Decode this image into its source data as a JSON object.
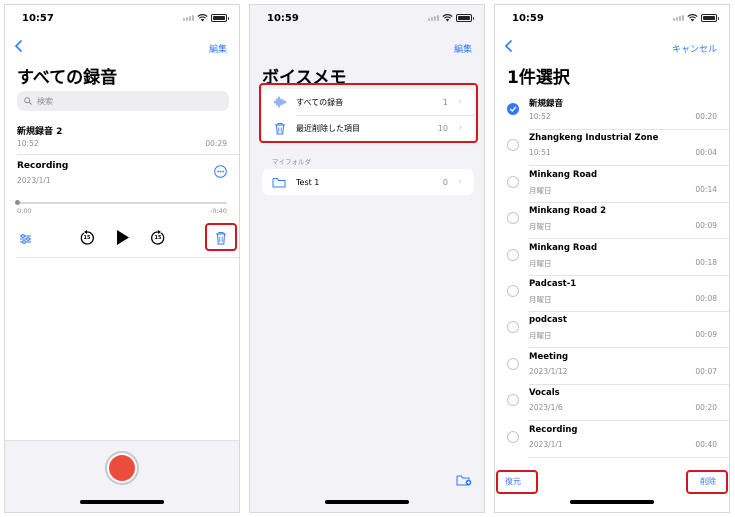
{
  "panel1": {
    "time": "10:57",
    "edit": "編集",
    "title": "すべての録音",
    "search_placeholder": "検索",
    "rec1": {
      "name": "新規録音 2",
      "date": "10:52",
      "duration": "00:29"
    },
    "rec2": {
      "name": "Recording",
      "date": "2023/1/1",
      "elapsed": "0:00",
      "remaining": "-0:40",
      "progress": 0.0
    },
    "icons": [
      "back-chevron",
      "search",
      "more",
      "options",
      "skip-back-15",
      "play",
      "skip-forward-15",
      "trash",
      "record"
    ],
    "skip_label": "15"
  },
  "panel2": {
    "time": "10:59",
    "edit": "編集",
    "title": "ボイスメモ",
    "rows": [
      {
        "label": "すべての録音",
        "count": "1"
      },
      {
        "label": "最近削除した項目",
        "count": "10"
      }
    ],
    "section": "マイフォルダ",
    "folder": {
      "label": "Test 1",
      "count": "0"
    }
  },
  "panel3": {
    "time": "10:59",
    "cancel": "キャンセル",
    "title": "1件選択",
    "items": [
      {
        "name": "新規録音",
        "date": "10:52",
        "duration": "00:20",
        "selected": true
      },
      {
        "name": "Zhangkeng Industrial Zone",
        "date": "10:51",
        "duration": "00:04",
        "selected": false
      },
      {
        "name": "Minkang Road",
        "date": "月曜日",
        "duration": "00:14",
        "selected": false
      },
      {
        "name": "Minkang Road 2",
        "date": "月曜日",
        "duration": "00:09",
        "selected": false
      },
      {
        "name": "Minkang Road",
        "date": "月曜日",
        "duration": "00:18",
        "selected": false
      },
      {
        "name": "Padcast-1",
        "date": "月曜日",
        "duration": "00:08",
        "selected": false
      },
      {
        "name": "podcast",
        "date": "月曜日",
        "duration": "00:09",
        "selected": false
      },
      {
        "name": "Meeting",
        "date": "2023/1/12",
        "duration": "00:07",
        "selected": false
      },
      {
        "name": "Vocals",
        "date": "2023/1/6",
        "duration": "00:20",
        "selected": false
      },
      {
        "name": "Recording",
        "date": "2023/1/1",
        "duration": "00:40",
        "selected": false
      }
    ],
    "recover": "復元",
    "delete": "削除"
  },
  "colors": {
    "accent": "#3478f6",
    "highlight": "#d6161f",
    "record": "#eb4d3d"
  }
}
